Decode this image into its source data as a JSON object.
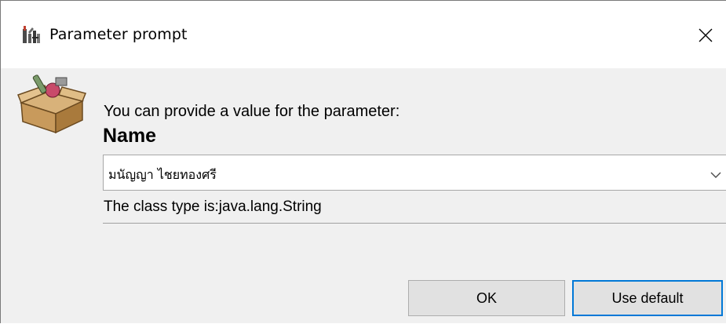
{
  "window": {
    "title": "Parameter prompt",
    "icon": "ireport-app-icon",
    "close_icon": "close-icon"
  },
  "dialog": {
    "icon": "open-box-icon",
    "prompt": "You can provide a value for the parameter:",
    "parameter_name": "Name",
    "value": "มนัญญา ไชยทองศรี",
    "class_type": "The class type is:java.lang.String"
  },
  "buttons": {
    "ok_label": "OK",
    "default_label": "Use default"
  },
  "colors": {
    "titlebar_bg": "#ffffff",
    "dialog_bg": "#f0f0f0",
    "button_bg": "#e1e1e1",
    "focus_border": "#0078d7"
  }
}
